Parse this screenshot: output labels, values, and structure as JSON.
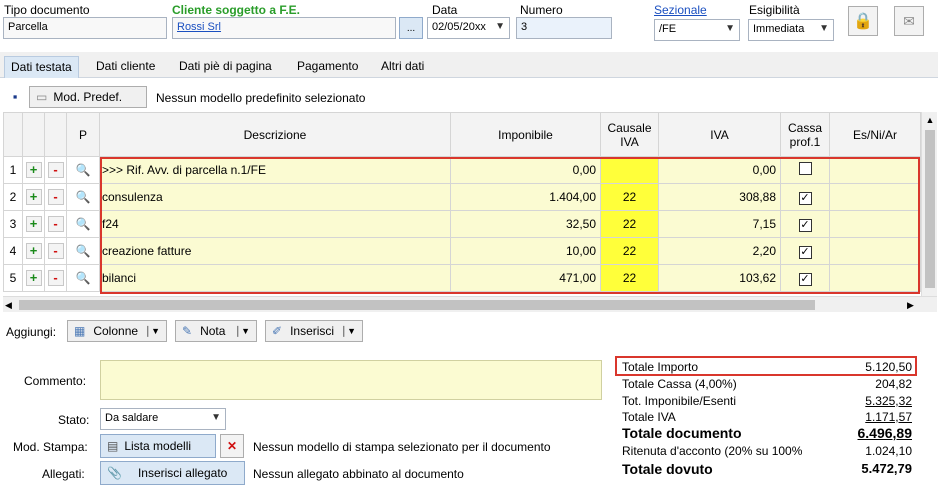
{
  "header": {
    "tipo_label": "Tipo documento",
    "tipo_value": "Parcella",
    "cliente_label": "Cliente soggetto a F.E.",
    "cliente_value": "Rossi Srl",
    "browse_label": "...",
    "data_label": "Data",
    "data_value": "02/05/20xx",
    "numero_label": "Numero",
    "numero_value": "3",
    "sezionale_label": "Sezionale",
    "sezionale_value": "/FE",
    "esig_label": "Esigibilità",
    "esig_value": "Immediata"
  },
  "tabs": [
    "Dati testata",
    "Dati cliente",
    "Dati piè di pagina",
    "Pagamento",
    "Altri dati"
  ],
  "toolbar": {
    "mod_predef": "Mod. Predef.",
    "mod_note": "Nessun modello predefinito selezionato"
  },
  "grid": {
    "headers": {
      "p": "P",
      "descr": "Descrizione",
      "imp": "Imponibile",
      "caus": "Causale IVA",
      "iva": "IVA",
      "cassa": "Cassa prof.1",
      "es": "Es/Ni/Ar"
    },
    "rows": [
      {
        "n": "1",
        "descr": ">>> Rif. Avv. di parcella n.1/FE",
        "imp": "0,00",
        "caus": "",
        "iva": "0,00",
        "checked": false
      },
      {
        "n": "2",
        "descr": "consulenza",
        "imp": "1.404,00",
        "caus": "22",
        "iva": "308,88",
        "checked": true
      },
      {
        "n": "3",
        "descr": "f24",
        "imp": "32,50",
        "caus": "22",
        "iva": "7,15",
        "checked": true
      },
      {
        "n": "4",
        "descr": "creazione fatture",
        "imp": "10,00",
        "caus": "22",
        "iva": "2,20",
        "checked": true
      },
      {
        "n": "5",
        "descr": "bilanci",
        "imp": "471,00",
        "caus": "22",
        "iva": "103,62",
        "checked": true
      }
    ]
  },
  "aggiungi": {
    "label": "Aggiungi:",
    "colonne": "Colonne",
    "nota": "Nota",
    "inserisci": "Inserisci"
  },
  "bottom": {
    "commento_label": "Commento:",
    "stato_label": "Stato:",
    "stato_value": "Da saldare",
    "stampa_label": "Mod. Stampa:",
    "lista_modelli": "Lista modelli",
    "stampa_note": "Nessun modello di stampa selezionato per il documento",
    "allegati_label": "Allegati:",
    "inserisci_allegato": "Inserisci allegato",
    "allegati_note": "Nessun allegato abbinato al documento"
  },
  "totals": {
    "importo_label": "Totale Importo",
    "importo": "5.120,50",
    "cassa_label": "Totale Cassa (4,00%)",
    "cassa": "204,82",
    "imponibile_label": "Tot. Imponibile/Esenti",
    "imponibile": "5.325,32",
    "iva_label": "Totale IVA",
    "iva": "1.171,57",
    "documento_label": "Totale documento",
    "documento": "6.496,89",
    "ritenuta_label": "Ritenuta d'acconto (20% su 100%",
    "ritenuta": "1.024,10",
    "dovuto_label": "Totale dovuto",
    "dovuto": "5.472,79"
  },
  "colors": {
    "accent_green": "#2a9d2a",
    "highlight_red": "#d9362c",
    "causale_yellow": "#ffff3a"
  }
}
